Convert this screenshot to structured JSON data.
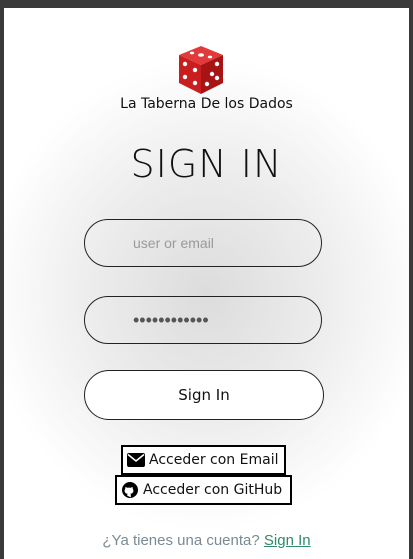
{
  "brand": {
    "name": "La Taberna De los Dados",
    "logo_icon": "dice-icon"
  },
  "page": {
    "title": "SIGN IN"
  },
  "form": {
    "email_placeholder": "user or email",
    "password_value": "••••••••••••",
    "submit_label": "Sign In"
  },
  "oauth": {
    "email_label": "Acceder con Email",
    "email_icon": "envelope-icon",
    "github_label": "Acceder con GitHub",
    "github_icon": "github-icon"
  },
  "footer": {
    "prompt": "¿Ya tienes una cuenta?",
    "link_label": "Sign In"
  },
  "colors": {
    "dice_red": "#c81e1e",
    "link": "#2f8a6a",
    "frame": "#3a3a3a"
  }
}
